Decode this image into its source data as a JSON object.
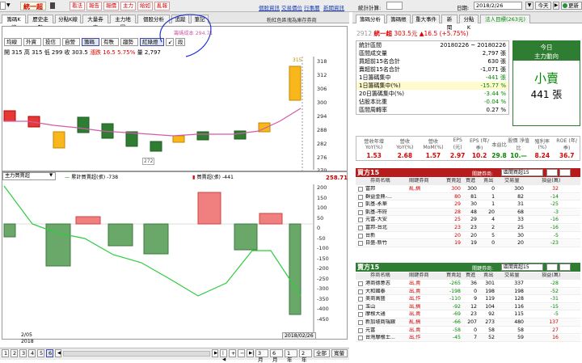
{
  "toolbar": {
    "stock_code": "",
    "stock_name": "統一超",
    "buttons": [
      "看法",
      "報告",
      "報價",
      "主力",
      "給如",
      "亂報"
    ],
    "links": [
      "個股資訊",
      "交易價位",
      "行事曆",
      "新聞資訊"
    ],
    "stat_label": "統計計算:",
    "date_label": "日期:",
    "date": "2018/2/26",
    "today": "今天",
    "refresh": "更新"
  },
  "left_tabs": [
    "籌碼K線",
    "歷史走勢",
    "分點K線",
    "大量券商",
    "主力地圖",
    "個股分析",
    "追蹤",
    "筆記"
  ],
  "left_note": "粉紅色區塊為庫存券商",
  "sub_buttons": [
    "均線",
    "外資",
    "投信",
    "自營",
    "籌碼",
    "有秩",
    "趨勢",
    "紅綠燈",
    "↙",
    "段"
  ],
  "ohlc": {
    "open_label": "開",
    "open": "315",
    "high_label": "高",
    "high": "315",
    "low_label": "低",
    "low": "299",
    "close_label": "收",
    "close": "303.5",
    "change_label": "漲跌",
    "change": "16.5",
    "pct": "5.75%",
    "vol_label": "量",
    "vol": "2,797"
  },
  "price_chart": {
    "avg_label": "籌碼成本",
    "avg": "294.71",
    "high_marker": "315",
    "low_marker": "272",
    "yticks": [
      "318",
      "312",
      "306",
      "300",
      "294",
      "288",
      "282",
      "276",
      "270"
    ]
  },
  "lower_chart": {
    "select": "主力買賣超",
    "legend_cum": "累計買賣超(張)",
    "legend_cum_value": "-738",
    "legend_net": "買賣超(張)",
    "legend_net_value": "-441",
    "current": "258.71",
    "yticks": [
      "200",
      "150",
      "100",
      "50",
      "0",
      "-50",
      "-100",
      "-150",
      "-200",
      "-250",
      "-300",
      "-350",
      "-400",
      "-450"
    ],
    "xdate": "2/05",
    "xyear": "2018",
    "crosshair_date": "2018/02/26"
  },
  "bottom_buttons": [
    "1",
    "2",
    "3",
    "4",
    "5",
    "6"
  ],
  "range_buttons": [
    "3月",
    "6月",
    "1年",
    "2年",
    "全部",
    "寬螢"
  ],
  "right_tabs": [
    "籌碼分析",
    "籌碼帳",
    "重大事件",
    "新聞",
    "分點K",
    "法人目標(263元)"
  ],
  "summary": {
    "code": "2912",
    "name": "統一超",
    "price": "303.5元",
    "change": "▲16.5 (+5.75%)",
    "rows": [
      [
        "統計區間",
        "20180226 ~ 20180226"
      ],
      [
        "區間成交量",
        "2,797 張"
      ],
      [
        "買超前15名合計",
        "630 張"
      ],
      [
        "賣超前15名合計",
        "-1,071 張"
      ],
      [
        "1日籌碼集中",
        "-441 張"
      ],
      [
        "1日籌碼集中(%)",
        "-15.77 %"
      ],
      [
        "20日籌碼集中(%)",
        "-3.44 %"
      ],
      [
        "佔股本比重",
        "-0.04 %"
      ],
      [
        "區間周轉率",
        "0.27 %"
      ]
    ],
    "today_title": "今日",
    "today_sub": "主力動向",
    "today_action": "小賣",
    "today_vol": "441 張"
  },
  "fund": {
    "headers": [
      "營收年增 YoY(%)",
      "營收 YoY(%)",
      "營收 MoM(%)",
      "EPS (元)",
      "EPS (年/季)",
      "本益比",
      "股價 淨值比",
      "殖利率 (%)",
      "ROE (年/季)"
    ],
    "values": [
      "1.53",
      "2.68",
      "1.57",
      "2.97",
      "10.2",
      "29.8",
      "10.—",
      "8.24",
      "36.7"
    ]
  },
  "buy": {
    "title": "買方15",
    "label": "關鍵券商:",
    "select": "區間買超15",
    "cols": [
      "券商名稱",
      "關鍵券商",
      "買賣超",
      "買進",
      "賣出",
      "交易量",
      "損益(萬)"
    ],
    "rows": [
      [
        "富邦",
        "亂,搞",
        "300",
        "300",
        "0",
        "300",
        "32"
      ],
      [
        "群益金鼎-...",
        "",
        "80",
        "81",
        "1",
        "82",
        "-14"
      ],
      [
        "凱基-永華",
        "",
        "29",
        "30",
        "1",
        "31",
        "-25"
      ],
      [
        "凱基-市府",
        "",
        "28",
        "48",
        "20",
        "68",
        "-3"
      ],
      [
        "元富-大安",
        "",
        "25",
        "29",
        "4",
        "33",
        "-16"
      ],
      [
        "富邦-台北",
        "",
        "23",
        "23",
        "2",
        "25",
        "-16"
      ],
      [
        "台新",
        "",
        "20",
        "20",
        "5",
        "30",
        "-5"
      ],
      [
        "日盛-新竹",
        "",
        "19",
        "19",
        "0",
        "20",
        "-23"
      ]
    ]
  },
  "sell": {
    "title": "賣方15",
    "label": "關鍵券商:",
    "select": "區間賣超15",
    "cols": [
      "券商名稱",
      "關鍵券商",
      "買賣超",
      "買進",
      "賣出",
      "交易量",
      "損益(萬)"
    ],
    "rows": [
      [
        "港商德意志",
        "出,賣",
        "-265",
        "36",
        "301",
        "337",
        "-28"
      ],
      [
        "大和國泰",
        "出,賣",
        "-198",
        "0",
        "198",
        "198",
        "-52"
      ],
      [
        "美商高盛",
        "出,作",
        "-110",
        "9",
        "119",
        "128",
        "-31"
      ],
      [
        "玉山",
        "出,搞",
        "-92",
        "12",
        "104",
        "116",
        "-15"
      ],
      [
        "摩根大通",
        "出,賣",
        "-69",
        "23",
        "92",
        "115",
        "-5"
      ],
      [
        "新加坡商瑞銀",
        "亂,搞",
        "-66",
        "207",
        "273",
        "480",
        "137"
      ],
      [
        "元富",
        "出,賣",
        "-58",
        "0",
        "58",
        "58",
        "27"
      ],
      [
        "台灣摩根士...",
        "出,作",
        "-45",
        "7",
        "52",
        "59",
        "16"
      ]
    ]
  }
}
